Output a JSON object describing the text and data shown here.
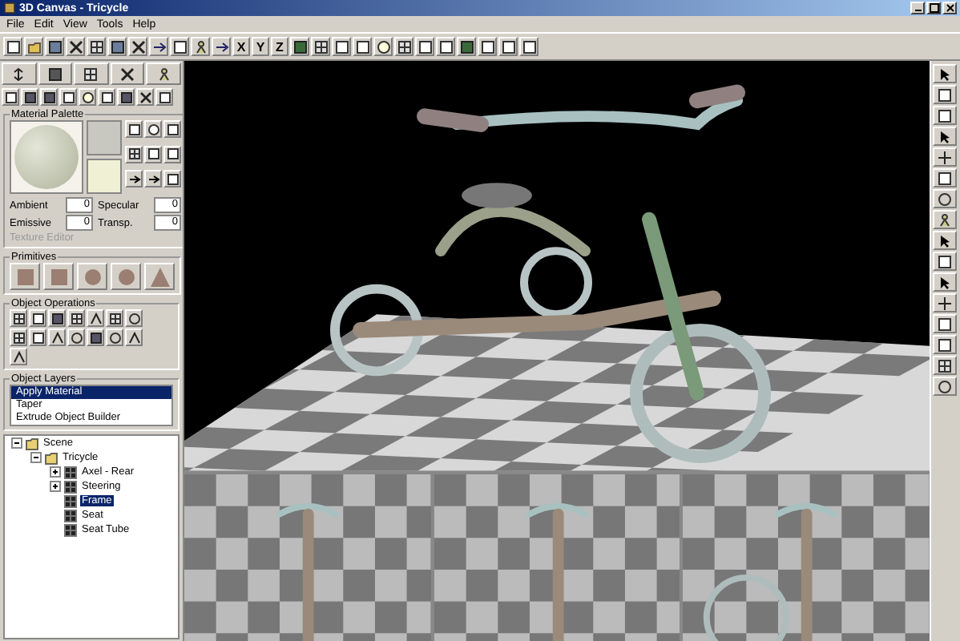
{
  "window": {
    "title": "3D Canvas - Tricycle"
  },
  "menu": [
    "File",
    "Edit",
    "View",
    "Tools",
    "Help"
  ],
  "axis_buttons": [
    "X",
    "Y",
    "Z"
  ],
  "material_palette": {
    "title": "Material Palette",
    "fields": [
      {
        "label": "Ambient",
        "value": "0"
      },
      {
        "label": "Specular",
        "value": "0"
      },
      {
        "label": "Emissive",
        "value": "0"
      },
      {
        "label": "Transp.",
        "value": "0"
      }
    ],
    "texture_editor": {
      "label": "Texture Editor",
      "disabled": true
    }
  },
  "primitives": {
    "title": "Primitives"
  },
  "object_operations": {
    "title": "Object Operations"
  },
  "object_layers": {
    "title": "Object Layers",
    "rows": [
      {
        "label": "Apply Material",
        "selected": true
      },
      {
        "label": "Taper",
        "selected": false
      },
      {
        "label": "Extrude Object Builder",
        "selected": false
      }
    ]
  },
  "scene_tree": [
    {
      "label": "Scene",
      "expanded": true,
      "selected": false,
      "children": [
        {
          "label": "Tricycle",
          "expanded": true,
          "selected": false,
          "children": [
            {
              "label": "Axel - Rear",
              "expanded": false,
              "selected": false
            },
            {
              "label": "Steering",
              "expanded": false,
              "selected": false
            },
            {
              "label": "Frame",
              "selected": true
            },
            {
              "label": "Seat",
              "selected": false
            },
            {
              "label": "Seat Tube",
              "selected": false
            }
          ]
        }
      ]
    }
  ]
}
